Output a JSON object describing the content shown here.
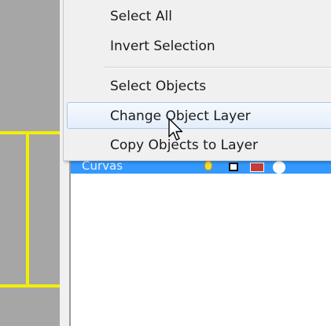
{
  "context_menu": {
    "items": [
      {
        "label": "Select All"
      },
      {
        "label": "Invert Selection"
      },
      {
        "label": "Select Objects"
      },
      {
        "label": "Change Object Layer"
      },
      {
        "label": "Copy Objects to Layer"
      }
    ],
    "highlighted_item": "Change Object Layer"
  },
  "layer_panel": {
    "selected_layer": {
      "name": "Curvas",
      "visibility_icon": "lightbulb-icon",
      "lock_icon": "unlocked-square-icon",
      "color": "#c73a3a",
      "material_icon": "material-circle-icon"
    }
  },
  "viewport": {
    "background_color": "#a6a6a6",
    "geometry_color": "#f2ef00"
  },
  "colors": {
    "selection_blue": "#3399ff",
    "menu_background": "#f0f0f0",
    "menu_hover_border": "#a8c7ee"
  }
}
